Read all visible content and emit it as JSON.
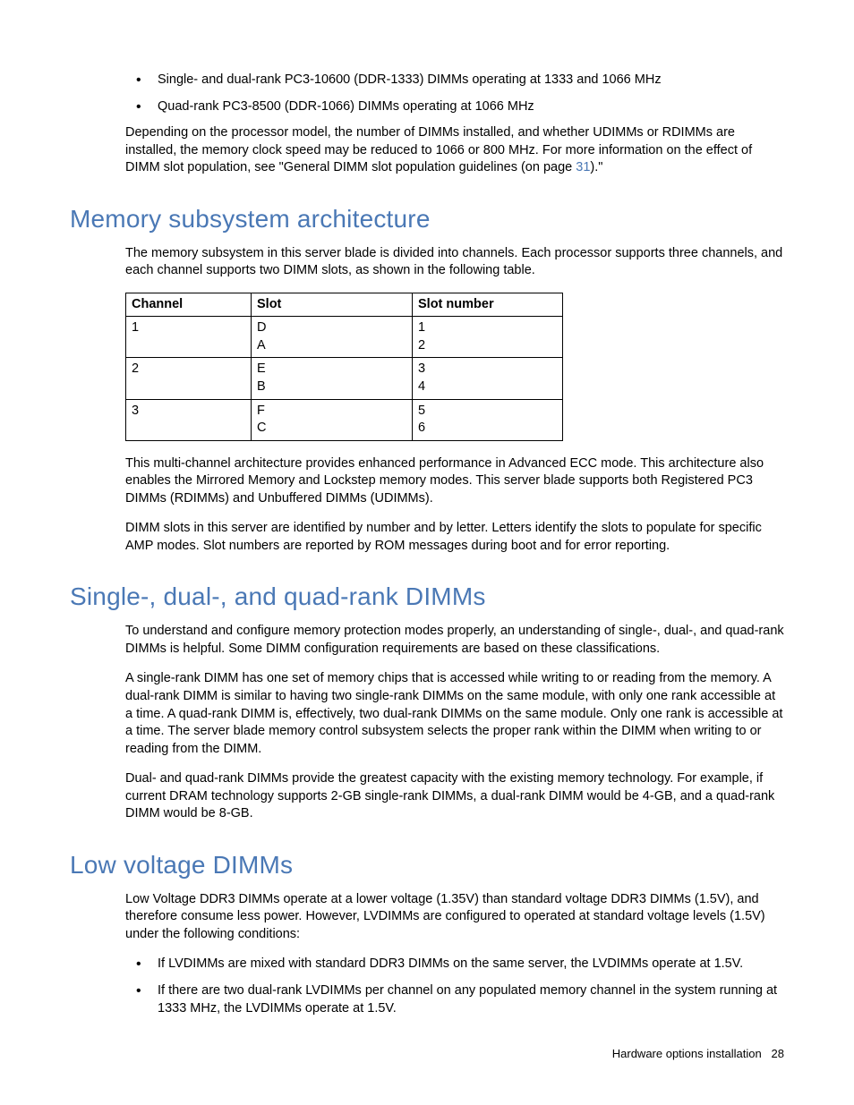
{
  "intro_bullets": [
    "Single- and dual-rank PC3-10600 (DDR-1333) DIMMs operating at 1333 and 1066 MHz",
    "Quad-rank PC3-8500 (DDR-1066) DIMMs operating at 1066 MHz"
  ],
  "intro_paragraph_pre": "Depending on the processor model, the number of DIMMs installed, and whether UDIMMs or RDIMMs are installed, the memory clock speed may be reduced to 1066 or 800 MHz. For more information on the effect of DIMM slot population, see \"General DIMM slot population guidelines (on page ",
  "intro_link": "31",
  "intro_paragraph_post": ").\"",
  "section1": {
    "heading": "Memory subsystem architecture",
    "p1": "The memory subsystem in this server blade is divided into channels. Each processor supports three channels, and each channel supports two DIMM slots, as shown in the following table.",
    "table": {
      "headers": [
        "Channel",
        "Slot",
        "Slot number"
      ],
      "rows": [
        {
          "channel": "1",
          "slots": [
            "D",
            "A"
          ],
          "numbers": [
            "1",
            "2"
          ]
        },
        {
          "channel": "2",
          "slots": [
            "E",
            "B"
          ],
          "numbers": [
            "3",
            "4"
          ]
        },
        {
          "channel": "3",
          "slots": [
            "F",
            "C"
          ],
          "numbers": [
            "5",
            "6"
          ]
        }
      ]
    },
    "p2": "This multi-channel architecture provides enhanced performance in Advanced ECC mode. This architecture also enables the Mirrored Memory and Lockstep memory modes. This server blade supports both Registered PC3 DIMMs (RDIMMs) and Unbuffered DIMMs (UDIMMs).",
    "p3": "DIMM slots in this server are identified by number and by letter. Letters identify the slots to populate for specific AMP modes. Slot numbers are reported by ROM messages during boot and for error reporting."
  },
  "section2": {
    "heading": "Single-, dual-, and quad-rank DIMMs",
    "p1": "To understand and configure memory protection modes properly, an understanding of single-, dual-, and quad-rank DIMMs is helpful. Some DIMM configuration requirements are based on these classifications.",
    "p2": "A single-rank DIMM has one set of memory chips that is accessed while writing to or reading from the memory. A dual-rank DIMM is similar to having two single-rank DIMMs on the same module, with only one rank accessible at a time. A quad-rank DIMM is, effectively, two dual-rank DIMMs on the same module. Only one rank is accessible at a time. The server blade memory control subsystem selects the proper rank within the DIMM when writing to or reading from the DIMM.",
    "p3": "Dual- and quad-rank DIMMs provide the greatest capacity with the existing memory technology. For example, if current DRAM technology supports 2-GB single-rank DIMMs, a dual-rank DIMM would be 4-GB, and a quad-rank DIMM would be 8-GB."
  },
  "section3": {
    "heading": "Low voltage DIMMs",
    "p1": "Low Voltage DDR3 DIMMs operate at a lower voltage (1.35V) than standard voltage DDR3 DIMMs (1.5V), and therefore consume less power. However, LVDIMMs are configured to operated at standard voltage levels (1.5V) under the following conditions:",
    "bullets": [
      "If LVDIMMs are mixed with standard DDR3 DIMMs on the same server, the LVDIMMs operate at 1.5V.",
      "If there are two dual-rank LVDIMMs per channel on any populated memory channel in the system running at 1333 MHz, the LVDIMMs operate at 1.5V."
    ]
  },
  "footer": {
    "label": "Hardware options installation",
    "page": "28"
  }
}
